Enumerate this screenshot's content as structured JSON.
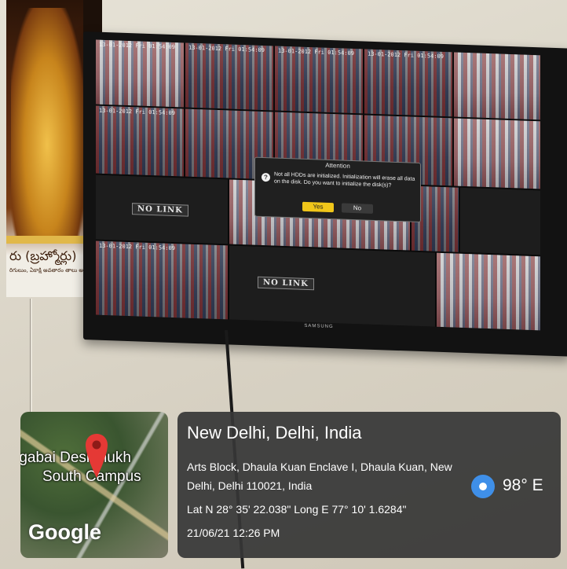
{
  "poster": {
    "text_line1": "రు (బ్రహ్మోర్లు)",
    "text_line2": "రిగులుం, ఏకాక్షి అవతారం తాలు అధిష్టి"
  },
  "tv": {
    "brand": "SAMSUNG",
    "timestamps": [
      "13-01-2012 Fri 01:54:09",
      "13-01-2012 Fri 01:54:09",
      "13-01-2012 Fri 01:54:09",
      "13-01-2012 Fri 01:54:09",
      "13-01-2012 Fri 01:54:09",
      "13-01-2012 Fri 01:54:09"
    ],
    "no_link_label": "NO LINK",
    "dialog": {
      "title": "Attention",
      "message": "Not all HDDs are initialized. Initialization will erase all data on the disk. Do you want to initialize the disk(s)?",
      "yes_label": "Yes",
      "no_label": "No"
    }
  },
  "map": {
    "place_line1": "rgabai Deshmukh",
    "place_line2": "South Campus",
    "logo": "Google"
  },
  "location": {
    "city": "New Delhi, Delhi, India",
    "address": "Arts Block, Dhaula Kuan Enclave I, Dhaula Kuan, New Delhi, Delhi 110021, India",
    "coordinates": "Lat N 28° 35' 22.038\" Long E 77° 10' 1.6284\"",
    "datetime": "21/06/21 12:26 PM",
    "heading": "98° E"
  },
  "colors": {
    "pin": "#e53935",
    "dialog_yes": "#f0c61a",
    "compass": "#3f8fe8"
  }
}
